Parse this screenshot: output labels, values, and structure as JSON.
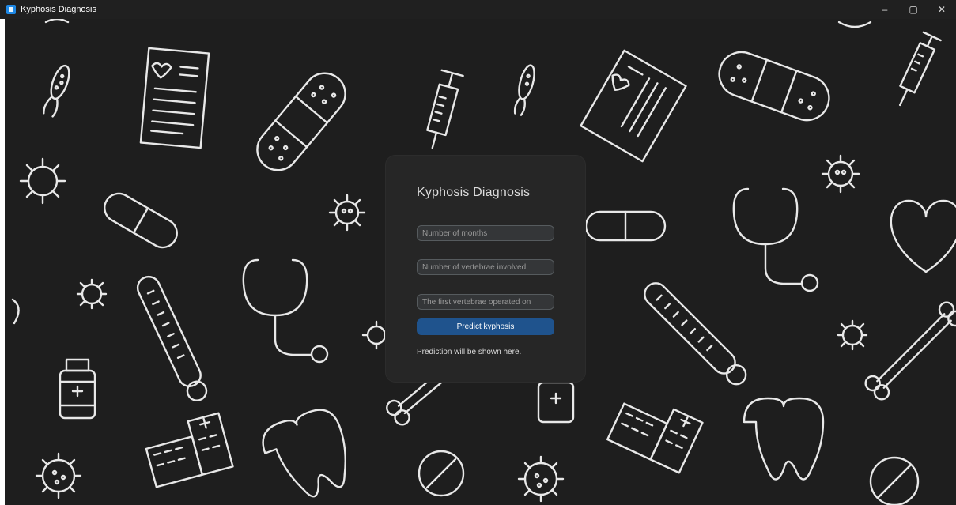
{
  "window": {
    "title": "Kyphosis Diagnosis",
    "controls": [
      "–",
      "▢",
      "✕"
    ]
  },
  "form": {
    "heading": "Kyphosis Diagnosis",
    "months_placeholder": "Number of months",
    "vertebrae_placeholder": "Number of vertebrae involved",
    "first_vertebra_placeholder": "The first vertebrae operated on",
    "predict_label": "Predict kyphosis",
    "result_text": "Prediction will be shown here."
  },
  "theme": {
    "accent": "#1f538d",
    "background": "#1e1e1e",
    "card": "#262626",
    "doodle": "#e8e8e8"
  }
}
